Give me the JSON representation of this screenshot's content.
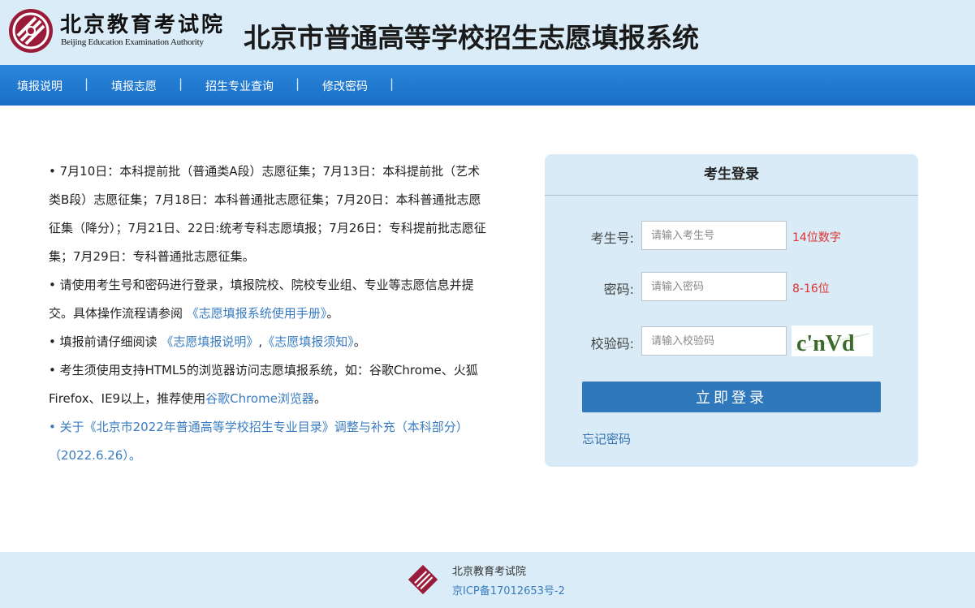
{
  "header": {
    "org_cn": "北京教育考试院",
    "org_en": "Beijing Education Examination Authority",
    "system_title": "北京市普通高等学校招生志愿填报系统",
    "emblem_color": "#9b1b3a"
  },
  "nav": {
    "items": [
      "填报说明",
      "填报志愿",
      "招生专业查询",
      "修改密码"
    ],
    "separator": "|"
  },
  "notices": {
    "n1": "• 7月10日：本科提前批（普通类A段）志愿征集；7月13日：本科提前批（艺术类B段）志愿征集；7月18日：本科普通批志愿征集；7月20日：本科普通批志愿征集（降分）；7月21日、22日:统考专科志愿填报；7月26日：专科提前批志愿征集；7月29日：专科普通批志愿征集。",
    "n2_text": "• 请使用考生号和密码进行登录，填报院校、院校专业组、专业等志愿信息并提交。具体操作流程请参阅",
    "n2_link": "《志愿填报系统使用手册》",
    "n2_end": "。",
    "n3_text": "• 填报前请仔细阅读",
    "n3_link1": "《志愿填报说明》",
    "n3_comma": ",",
    "n3_link2": "《志愿填报须知》",
    "n3_end": "。",
    "n4_text": "• 考生须使用支持HTML5的浏览器访问志愿填报系统，如：谷歌Chrome、火狐Firefox、IE9以上，推荐使用",
    "n4_link": "谷歌Chrome浏览器",
    "n4_end": "。",
    "n5": "• 关于《北京市2022年普通高等学校招生专业目录》调整与补充（本科部分）（2022.6.26）。"
  },
  "login": {
    "title": "考生登录",
    "id_label": "考生号:",
    "id_placeholder": "请输入考生号",
    "id_hint": "14位数字",
    "pwd_label": "密码:",
    "pwd_placeholder": "请输入密码",
    "pwd_hint": "8-16位",
    "captcha_label": "校验码:",
    "captcha_placeholder": "请输入校验码",
    "captcha_text": "c'nVd",
    "submit": "立即登录",
    "forgot": "忘记密码"
  },
  "footer": {
    "org": "北京教育考试院",
    "icp": "京ICP备17012653号-2"
  },
  "colors": {
    "header_bg": "#d9ecf7",
    "nav_bg": "#1f78d1",
    "login_bg": "#d8ebf6",
    "button": "#2f78bb",
    "hint_red": "#e0312f",
    "link_blue": "#3a7cc0"
  }
}
